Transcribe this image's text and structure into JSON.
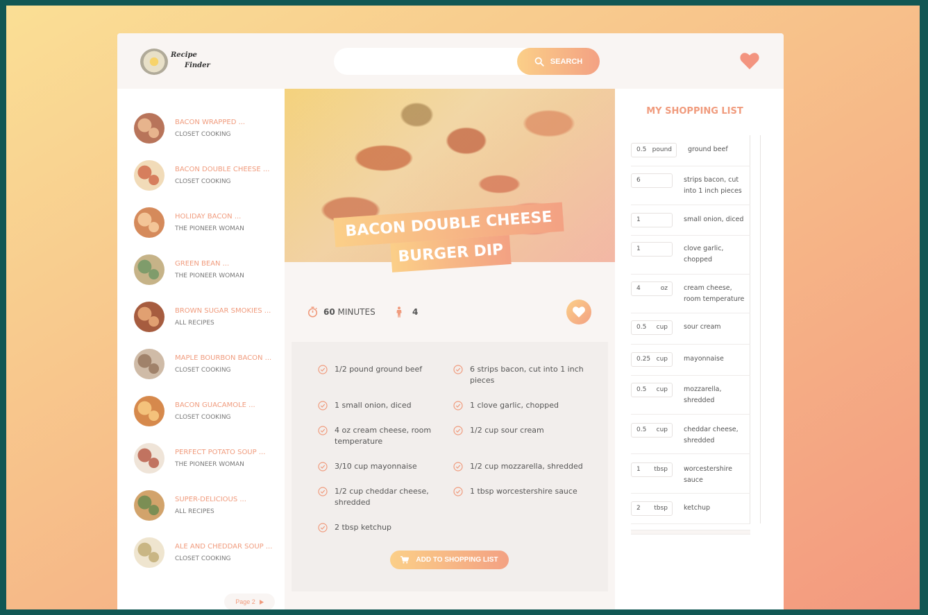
{
  "header": {
    "logo_line1": "Recipe",
    "logo_line2": "Finder",
    "search_placeholder": "",
    "search_label": "SEARCH"
  },
  "results": {
    "items": [
      {
        "title": "BACON WRAPPED ...",
        "author": "CLOSET COOKING"
      },
      {
        "title": "BACON DOUBLE CHEESE ...",
        "author": "CLOSET COOKING"
      },
      {
        "title": "HOLIDAY BACON ...",
        "author": "THE PIONEER WOMAN"
      },
      {
        "title": "GREEN BEAN ...",
        "author": "THE PIONEER WOMAN"
      },
      {
        "title": "BROWN SUGAR SMOKIES ...",
        "author": "ALL RECIPES"
      },
      {
        "title": "MAPLE BOURBON BACON ...",
        "author": "CLOSET COOKING"
      },
      {
        "title": "BACON GUACAMOLE ...",
        "author": "CLOSET COOKING"
      },
      {
        "title": "PERFECT POTATO SOUP ...",
        "author": "THE PIONEER WOMAN"
      },
      {
        "title": "SUPER-DELICIOUS ...",
        "author": "ALL RECIPES"
      },
      {
        "title": "ALE AND CHEDDAR SOUP ...",
        "author": "CLOSET COOKING"
      }
    ],
    "page_label": "Page 2"
  },
  "recipe": {
    "title_line1": "BACON DOUBLE CHEESE",
    "title_line2": "BURGER DIP",
    "time_value": "60",
    "time_unit": "MINUTES",
    "servings": "4",
    "ingredients": [
      "1/2 pound ground beef",
      "6 strips bacon, cut into 1 inch pieces",
      "1 small onion, diced",
      "1 clove garlic, chopped",
      "4 oz cream cheese, room temperature",
      "1/2 cup sour cream",
      "3/10 cup mayonnaise",
      "1/2 cup mozzarella, shredded",
      "1/2 cup cheddar cheese, shredded",
      "1 tbsp worcestershire sauce",
      "2 tbsp ketchup"
    ],
    "add_button": "ADD TO SHOPPING LIST"
  },
  "shopping": {
    "title": "MY SHOPPING LIST",
    "items": [
      {
        "count": "0.5",
        "unit": "pound",
        "desc": "ground beef"
      },
      {
        "count": "6",
        "unit": "",
        "desc": "strips bacon, cut into 1 inch pieces"
      },
      {
        "count": "1",
        "unit": "",
        "desc": "small onion, diced"
      },
      {
        "count": "1",
        "unit": "",
        "desc": "clove garlic, chopped"
      },
      {
        "count": "4",
        "unit": "oz",
        "desc": "cream cheese, room temperature"
      },
      {
        "count": "0.5",
        "unit": "cup",
        "desc": "sour cream"
      },
      {
        "count": "0.25",
        "unit": "cup",
        "desc": "mayonnaise"
      },
      {
        "count": "0.5",
        "unit": "cup",
        "desc": "mozzarella, shredded"
      },
      {
        "count": "0.5",
        "unit": "cup",
        "desc": "cheddar cheese, shredded"
      },
      {
        "count": "1",
        "unit": "tbsp",
        "desc": "worcestershire sauce"
      },
      {
        "count": "2",
        "unit": "tbsp",
        "desc": "ketchup"
      }
    ]
  },
  "colors": {
    "accent": "#f09b7d",
    "gradient_start": "#fbcf88",
    "gradient_end": "#f3a183",
    "background_frame": "#115754"
  },
  "icons": {
    "search": "search-icon",
    "favorites": "heart-icon",
    "time": "stopwatch-icon",
    "servings": "person-icon",
    "check": "check-circle-icon",
    "cart": "cart-icon",
    "next": "triangle-right-icon"
  }
}
